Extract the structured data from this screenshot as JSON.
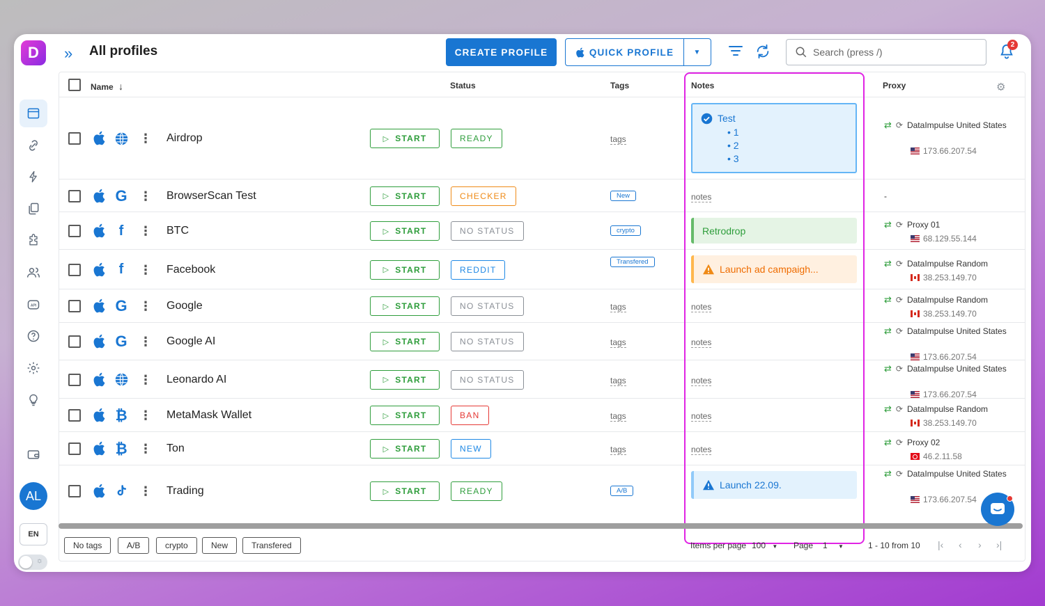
{
  "app": {
    "logo_letter": "D"
  },
  "header": {
    "title": "All profiles",
    "create_label": "CREATE PROFILE",
    "quick_label": "QUICK PROFILE",
    "search_placeholder": "Search (press /)",
    "notification_count": "2"
  },
  "sidebar": {
    "icons": [
      "browser-window-icon",
      "link-icon",
      "automation-icon",
      "copy-icon",
      "extension-icon",
      "team-icon",
      "api-icon",
      "help-icon",
      "settings-icon",
      "lightbulb-icon",
      "wallet-icon"
    ],
    "avatar_initials": "AL",
    "lang": "EN"
  },
  "table": {
    "columns": {
      "name": "Name",
      "status": "Status",
      "tags": "Tags",
      "notes": "Notes",
      "proxy": "Proxy"
    },
    "start_label": "START",
    "rows": [
      {
        "name": "Airdrop",
        "browser": "globe",
        "status": "READY",
        "status_color": "#2e9d3b",
        "tags": "tags",
        "tag_chip": null,
        "notes_placeholder": null,
        "note": {
          "type": "checklist",
          "title": "Test",
          "items": [
            "1",
            "2",
            "3"
          ],
          "bg": "#e3f2fd",
          "border": "#64b5f6",
          "color": "#1976d2"
        },
        "proxy": {
          "name": "DataImpulse United States",
          "ip": "173.66.207.54",
          "flag": "us"
        }
      },
      {
        "name": "BrowserScan Test",
        "browser": "google",
        "status": "CHECKER",
        "status_color": "#ef8a16",
        "tags": null,
        "tag_chip": "New",
        "notes_placeholder": "notes",
        "note": null,
        "proxy": {
          "name": "-",
          "ip": "",
          "flag": ""
        }
      },
      {
        "name": "BTC",
        "browser": "facebook",
        "status": "NO STATUS",
        "status_color": "#8a8f96",
        "tags": null,
        "tag_chip": "crypto",
        "notes_placeholder": null,
        "note": {
          "type": "text",
          "text": "Retrodrop",
          "bg": "#e5f4e5",
          "border": "#66bb6a",
          "color": "#2e9d3b"
        },
        "proxy": {
          "name": "Proxy 01",
          "ip": "68.129.55.144",
          "flag": "us"
        }
      },
      {
        "name": "Facebook",
        "browser": "facebook",
        "status": "REDDIT",
        "status_color": "#1e88e5",
        "tags": null,
        "tag_chip": "Transfered",
        "notes_placeholder": null,
        "note": {
          "type": "warning",
          "text": "Launch ad campaigh...",
          "bg": "#fff0e0",
          "border": "#ffb74d",
          "color": "#ef6c00"
        },
        "proxy": {
          "name": "DataImpulse Random",
          "ip": "38.253.149.70",
          "flag": "ca"
        }
      },
      {
        "name": "Google",
        "browser": "google",
        "status": "NO STATUS",
        "status_color": "#8a8f96",
        "tags": "tags",
        "tag_chip": null,
        "notes_placeholder": "notes",
        "note": null,
        "proxy": {
          "name": "DataImpulse Random",
          "ip": "38.253.149.70",
          "flag": "ca"
        }
      },
      {
        "name": "Google AI",
        "browser": "google",
        "status": "NO STATUS",
        "status_color": "#8a8f96",
        "tags": "tags",
        "tag_chip": null,
        "notes_placeholder": "notes",
        "note": null,
        "proxy": {
          "name": "DataImpulse United States",
          "ip": "173.66.207.54",
          "flag": "us"
        }
      },
      {
        "name": "Leonardo AI",
        "browser": "globe",
        "status": "NO STATUS",
        "status_color": "#8a8f96",
        "tags": "tags",
        "tag_chip": null,
        "notes_placeholder": "notes",
        "note": null,
        "proxy": {
          "name": "DataImpulse United States",
          "ip": "173.66.207.54",
          "flag": "us"
        }
      },
      {
        "name": "MetaMask Wallet",
        "browser": "bitcoin",
        "status": "BAN",
        "status_color": "#e53935",
        "tags": "tags",
        "tag_chip": null,
        "notes_placeholder": "notes",
        "note": null,
        "proxy": {
          "name": "DataImpulse Random",
          "ip": "38.253.149.70",
          "flag": "ca"
        }
      },
      {
        "name": "Ton",
        "browser": "bitcoin",
        "status": "NEW",
        "status_color": "#1e88e5",
        "tags": "tags",
        "tag_chip": null,
        "notes_placeholder": "notes",
        "note": null,
        "proxy": {
          "name": "Proxy 02",
          "ip": "46.2.11.58",
          "flag": "tr"
        }
      },
      {
        "name": "Trading",
        "browser": "tiktok",
        "status": "READY",
        "status_color": "#2e9d3b",
        "tags": null,
        "tag_chip": "A/B",
        "notes_placeholder": null,
        "note": {
          "type": "info",
          "text": "Launch 22.09.",
          "bg": "#e3f2fd",
          "border": "#90caf9",
          "color": "#1976d2"
        },
        "proxy": {
          "name": "DataImpulse United States",
          "ip": "173.66.207.54",
          "flag": "us"
        }
      }
    ]
  },
  "footer": {
    "tag_filters": [
      "No tags",
      "A/B",
      "crypto",
      "New",
      "Transfered"
    ],
    "items_per_page_label": "Items per page",
    "items_per_page": "100",
    "page_label": "Page",
    "page": "1",
    "range": "1 - 10 from 10"
  }
}
